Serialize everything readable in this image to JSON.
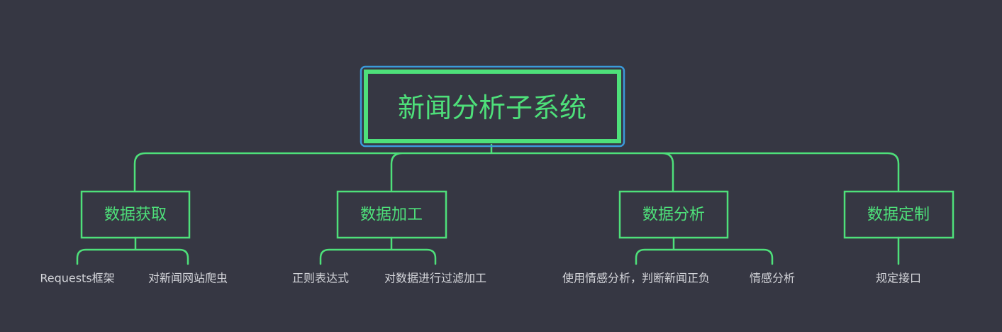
{
  "colors": {
    "background": "#363743",
    "accent": "#4ee07a",
    "selection": "#3b9ad9",
    "leaf_text": "#d4d5da"
  },
  "root": {
    "label": "新闻分析子系统"
  },
  "branches": [
    {
      "label": "数据获取",
      "leaves": [
        "Requests框架",
        "对新闻网站爬虫"
      ]
    },
    {
      "label": "数据加工",
      "leaves": [
        "正则表达式",
        "对数据进行过滤加工"
      ]
    },
    {
      "label": "数据分析",
      "leaves": [
        "使用情感分析，判断新闻正负",
        "情感分析"
      ]
    },
    {
      "label": "数据定制",
      "leaves": [
        "规定接口"
      ]
    }
  ]
}
